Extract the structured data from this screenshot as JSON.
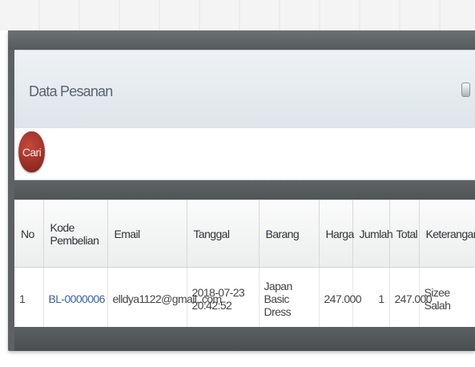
{
  "panel": {
    "title": "Data Pesanan"
  },
  "toolbar": {
    "cari_label": "Cari"
  },
  "table": {
    "headers": {
      "no": "No",
      "kode": "Kode Pembelian",
      "email": "Email",
      "tanggal": "Tanggal",
      "barang": "Barang",
      "harga": "Harga",
      "jumlah": "Jumlah",
      "total": "Total",
      "keterangan": "Keterangan"
    },
    "rows": [
      {
        "no": "1",
        "kode": "BL-0000006",
        "email": "elldya1122@gmail..com",
        "tanggal": "2018-07-23 20:42:52",
        "barang": "Japan Basic Dress",
        "harga": "247.000",
        "jumlah": "1",
        "total": "247.000",
        "keterangan": "Sizee Salah"
      }
    ]
  },
  "colors": {
    "frame": "#5d6163",
    "header_panel": "#e6ecf0",
    "cari_button": "#a7362b",
    "link": "#3a63a3"
  },
  "icons": {
    "collapse": "collapse-handle-icon"
  }
}
